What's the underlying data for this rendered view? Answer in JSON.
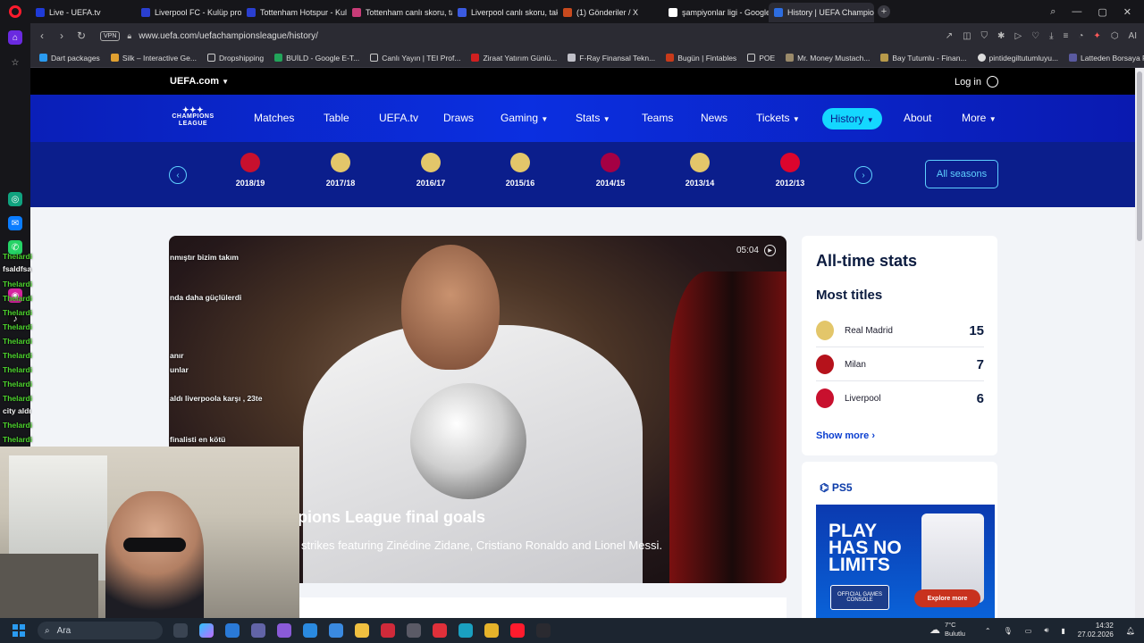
{
  "browser": {
    "tabs": [
      {
        "label": "Live - UEFA.tv",
        "color": "#1f3bd8"
      },
      {
        "label": "Liverpool FC - Kulüp profi",
        "color": "#2a3fd0"
      },
      {
        "label": "Tottenham Hotspur - Kulü",
        "color": "#2a3fd0"
      },
      {
        "label": "Tottenham canlı skoru, tak",
        "color": "#c83c78"
      },
      {
        "label": "Liverpool canlı skoru, takv",
        "color": "#3a5ae0"
      },
      {
        "label": "(1) Gönderiler / X",
        "color": "#c84a1e"
      },
      {
        "label": "şampiyonlar ligi - Google",
        "color": "#ffffff"
      },
      {
        "label": "History | UEFA Champions",
        "color": "#2d6de0"
      }
    ],
    "url": "www.uefa.com/uefachampionsleague/history/",
    "vpn_label": "VPN",
    "bookmarks": [
      "Dart packages",
      "Silk – Interactive Ge...",
      "Dropshipping",
      "BUİLD - Google E-T...",
      "Canlı Yayın | TEI Prof...",
      "Ziraat Yatırım Günlü...",
      "F-Ray Finansal Tekn...",
      "Bugün | Fintables",
      "POE",
      "Mr. Money Mustach...",
      "Bay Tutumlu - Finan...",
      "pintidegiltutumluyu...",
      "Latteden Borsaya Fi..."
    ]
  },
  "uefa": {
    "brand": "UEFA.com",
    "login": "Log in",
    "logo_line1": "CHAMPIONS",
    "logo_line2": "LEAGUE",
    "nav": [
      "Matches",
      "Table",
      "UEFA.tv",
      "Draws",
      "Gaming",
      "Stats",
      "Teams",
      "News",
      "Tickets",
      "History",
      "About",
      "More"
    ],
    "active_nav": "History",
    "seasons": [
      {
        "year": "2018/19",
        "crest": "#c8102e"
      },
      {
        "year": "2017/18",
        "crest": "#e3c66a"
      },
      {
        "year": "2016/17",
        "crest": "#e3c66a"
      },
      {
        "year": "2015/16",
        "crest": "#e3c66a"
      },
      {
        "year": "2014/15",
        "crest": "#a50044"
      },
      {
        "year": "2013/14",
        "crest": "#e3c66a"
      },
      {
        "year": "2012/13",
        "crest": "#dc052d"
      }
    ],
    "all_seasons": "All seasons",
    "video": {
      "duration": "05:04",
      "title_visible": "pions League final goals",
      "subtitle_visible": "strikes featuring Zinédine Zidane, Cristiano Ronaldo and Lionel Messi."
    },
    "stats": {
      "title": "All-time stats",
      "subtitle": "Most titles",
      "clubs": [
        {
          "name": "Real Madrid",
          "count": "15",
          "crest": "#e3c66a"
        },
        {
          "name": "Milan",
          "count": "7",
          "crest": "#b5121b"
        },
        {
          "name": "Liverpool",
          "count": "6",
          "crest": "#c8102e"
        }
      ],
      "show_more": "Show more"
    },
    "ad": {
      "brand": "PS5",
      "headline": "PLAY HAS NO LIMITS",
      "badge": "OFFICIAL GAMES CONSOLE",
      "cta": "Explore more"
    }
  },
  "chat": {
    "username": "Thelardi",
    "lines": [
      {
        "text": "nmıştır bizim takım"
      },
      {
        "text": "nda daha güçlülerdi"
      },
      {
        "text": "anır"
      },
      {
        "text": "unlar"
      },
      {
        "text": "aldı liverpoola karşı , 23te"
      },
      {
        "text": "finalisti en kötü"
      }
    ],
    "fragments": [
      "fsaldfsa",
      "city aldı"
    ]
  },
  "taskbar": {
    "search_placeholder": "Ara",
    "weather_temp": "7°C",
    "weather_desc": "Bulutlu",
    "time": "14:32",
    "date": "27.02.2026"
  }
}
